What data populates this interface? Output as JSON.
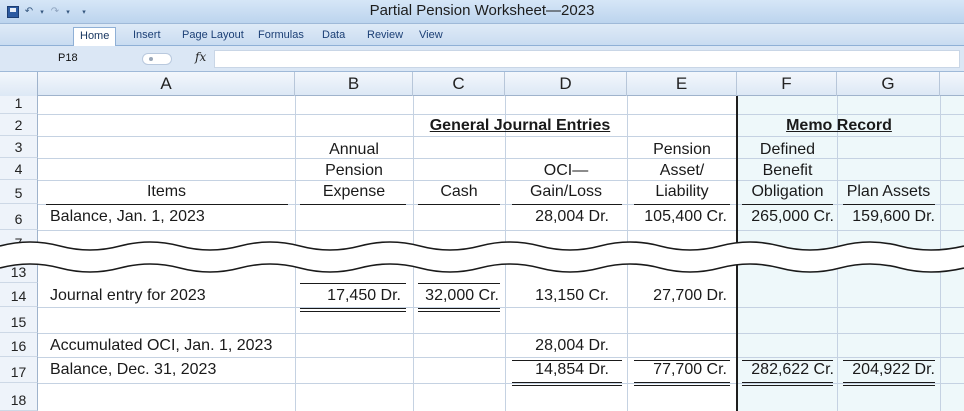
{
  "window": {
    "title": "Partial Pension Worksheet—2023"
  },
  "quick_access": {
    "save_icon": "save-icon",
    "undo_icon": "undo-icon",
    "redo_icon": "redo-icon",
    "customize_icon": "customize-icon"
  },
  "ribbon_tabs": [
    {
      "label": "Home",
      "active": true
    },
    {
      "label": "Insert"
    },
    {
      "label": "Page Layout"
    },
    {
      "label": "Formulas"
    },
    {
      "label": "Data"
    },
    {
      "label": "Review"
    },
    {
      "label": "View"
    }
  ],
  "formula_bar": {
    "cell_ref": "P18",
    "fx": "fx",
    "value": ""
  },
  "columns": [
    "A",
    "B",
    "C",
    "D",
    "E",
    "F",
    "G"
  ],
  "rows": [
    "1",
    "2",
    "3",
    "4",
    "5",
    "6",
    "7",
    "13",
    "14",
    "15",
    "16",
    "17",
    "18"
  ],
  "headers": {
    "general_journal": "General Journal Entries",
    "memo_record": "Memo Record",
    "items": "Items",
    "annual_pension_expense": [
      "Annual",
      "Pension",
      "Expense"
    ],
    "cash": "Cash",
    "oci": [
      "OCI—",
      "Gain/Loss"
    ],
    "pension_asset": [
      "Pension",
      "Asset/",
      "Liability"
    ],
    "dbo": [
      "Defined",
      "Benefit",
      "Obligation"
    ],
    "plan_assets": "Plan Assets"
  },
  "table": {
    "balance_jan": {
      "label": "Balance, Jan. 1, 2023",
      "oci": "28,004 Dr.",
      "pension_asset": "105,400 Cr.",
      "dbo": "265,000 Cr.",
      "plan_assets": "159,600 Dr."
    },
    "journal_entry": {
      "label": "Journal entry for 2023",
      "expense": "17,450 Dr.",
      "cash": "32,000 Cr.",
      "oci": "13,150 Cr.",
      "pension_asset": "27,700 Dr."
    },
    "accumulated_oci": {
      "label": "Accumulated OCI, Jan. 1, 2023",
      "oci": "28,004 Dr."
    },
    "balance_dec": {
      "label": "Balance, Dec. 31, 2023",
      "oci": "14,854 Dr.",
      "pension_asset": "77,700 Cr.",
      "dbo": "282,622 Cr.",
      "plan_assets": "204,922 Dr."
    }
  },
  "colors": {
    "memo_background": "#eef8fa",
    "ribbon": "#c9dcf1"
  }
}
